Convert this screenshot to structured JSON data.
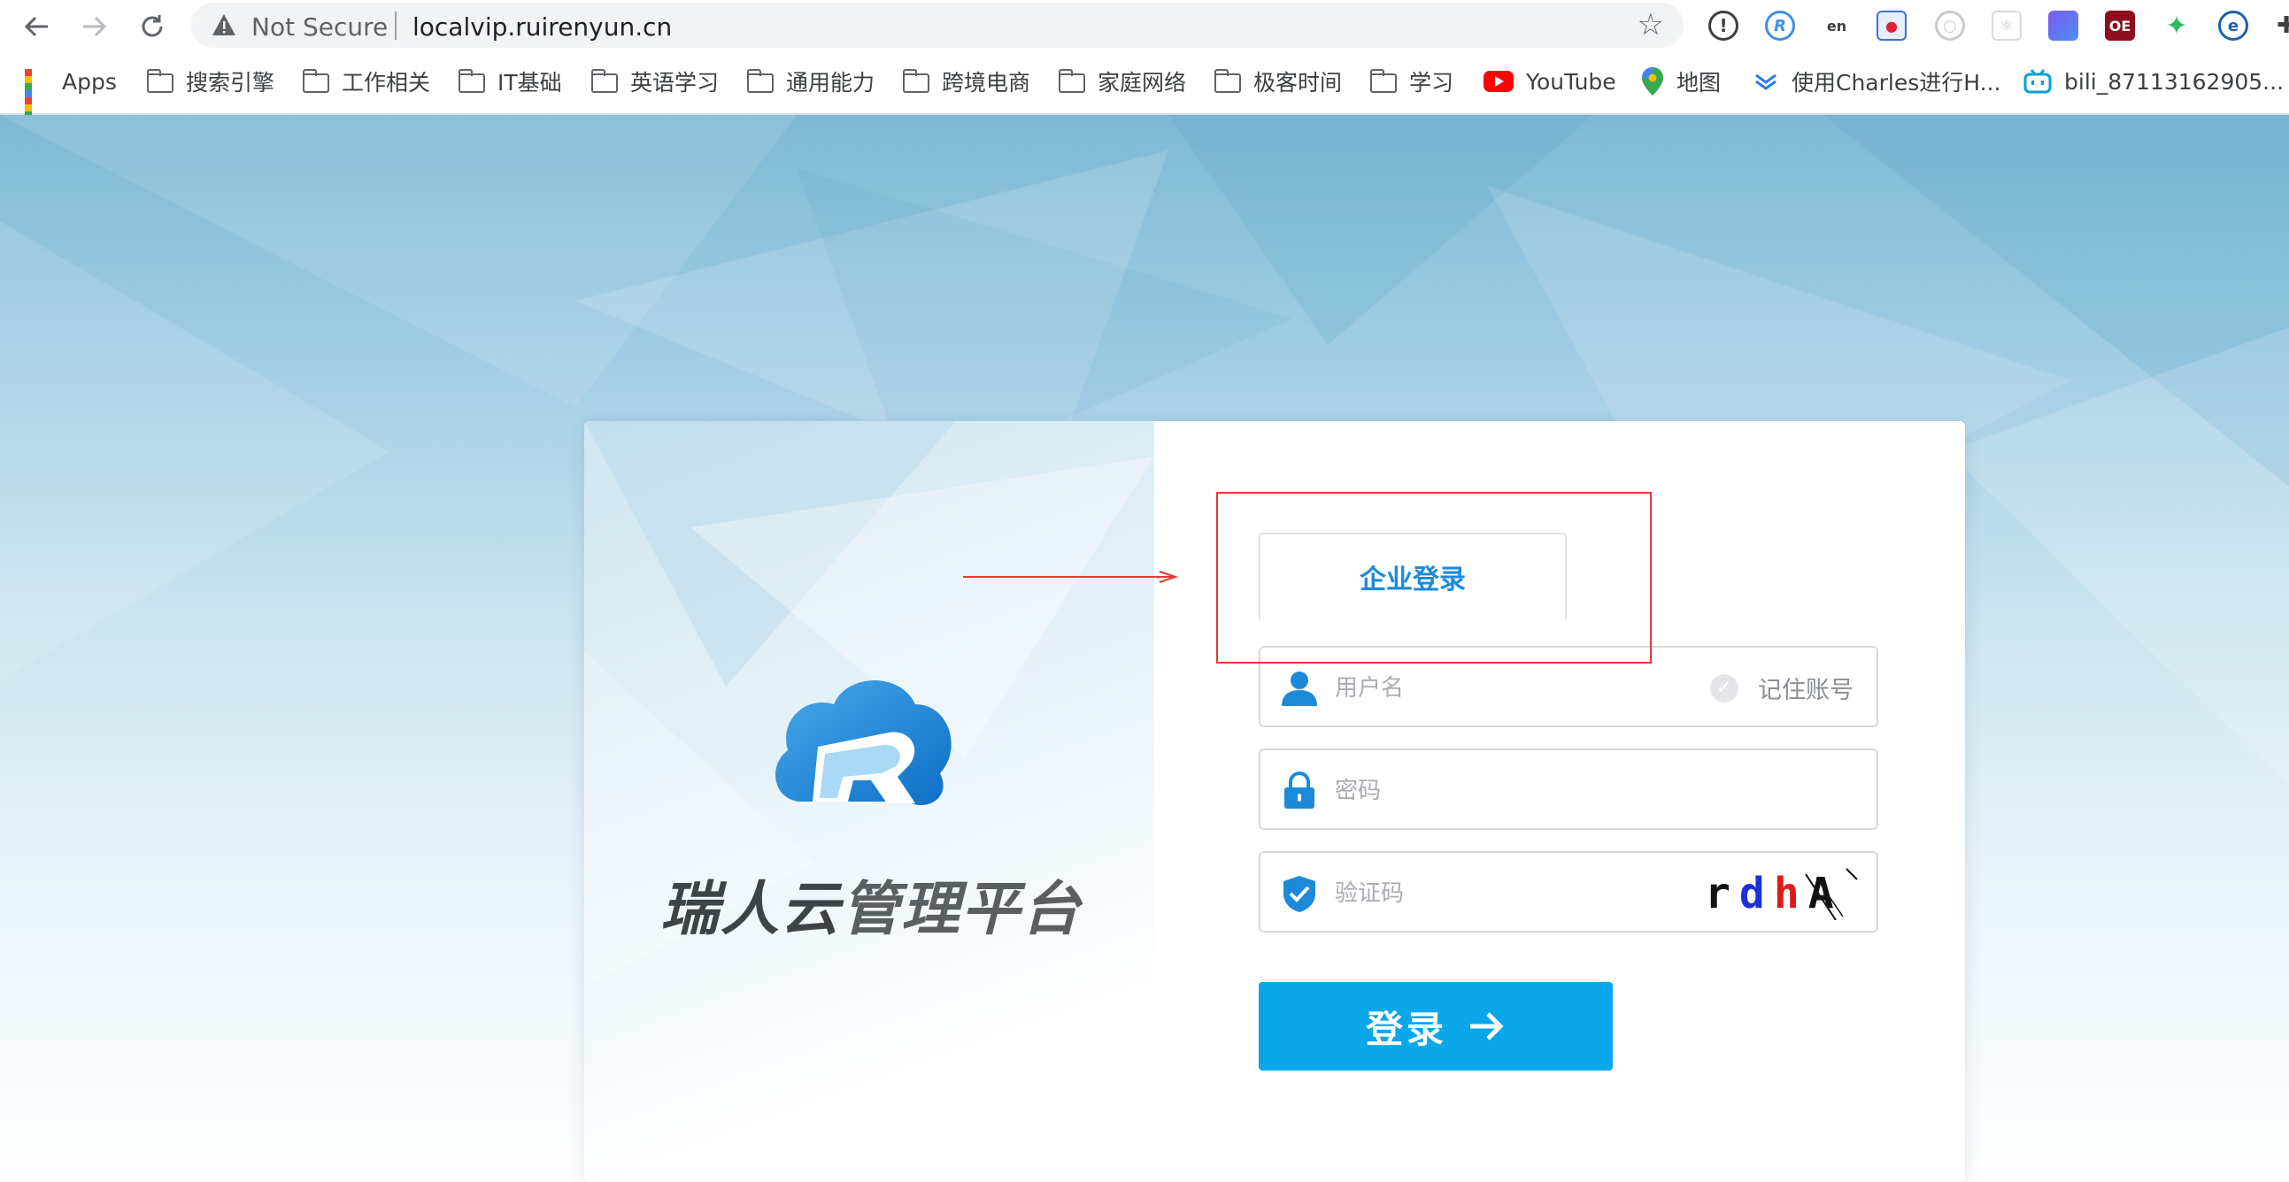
{
  "browser": {
    "security_label": "Not Secure",
    "url": "localvip.ruirenyun.cn",
    "bookmarks": [
      {
        "label": "Apps",
        "icon": "apps-grid-icon"
      },
      {
        "label": "搜索引擎",
        "icon": "folder-icon"
      },
      {
        "label": "工作相关",
        "icon": "folder-icon"
      },
      {
        "label": "IT基础",
        "icon": "folder-icon"
      },
      {
        "label": "英语学习",
        "icon": "folder-icon"
      },
      {
        "label": "通用能力",
        "icon": "folder-icon"
      },
      {
        "label": "跨境电商",
        "icon": "folder-icon"
      },
      {
        "label": "家庭网络",
        "icon": "folder-icon"
      },
      {
        "label": "极客时间",
        "icon": "folder-icon"
      },
      {
        "label": "学习",
        "icon": "folder-icon"
      },
      {
        "label": "YouTube",
        "icon": "youtube-icon"
      },
      {
        "label": "地图",
        "icon": "maps-pin-icon"
      },
      {
        "label": "使用Charles进行H...",
        "icon": "charles-icon"
      },
      {
        "label": "bili_87113162905...",
        "icon": "bilibili-icon"
      }
    ]
  },
  "brand": {
    "name_bold": "瑞人云",
    "name_light": "管理平台"
  },
  "login": {
    "tab_label": "企业登录",
    "username_placeholder": "用户名",
    "remember_label": "记住账号",
    "password_placeholder": "密码",
    "captcha_placeholder": "验证码",
    "captcha_text": "rdhA",
    "submit_label": "登录"
  },
  "colors": {
    "accent": "#0aa6ea",
    "tab_text": "#1c8ad8",
    "annotation": "#e53935"
  }
}
